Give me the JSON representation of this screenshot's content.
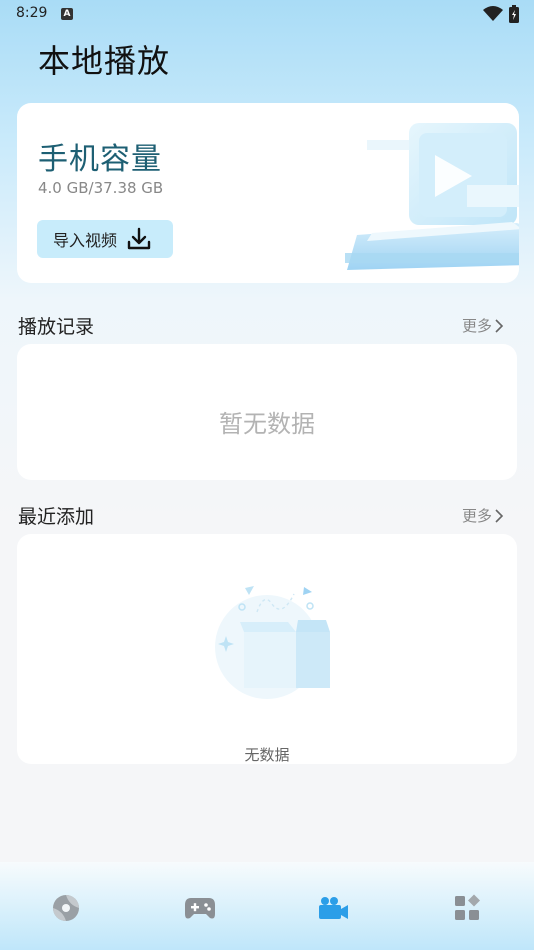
{
  "status_bar": {
    "time": "8:29",
    "notification_badge": "A"
  },
  "page": {
    "title": "本地播放"
  },
  "storage": {
    "title": "手机容量",
    "size": "4.0 GB/37.38 GB",
    "import_label": "导入视频",
    "import_icon": "download-icon"
  },
  "history": {
    "title": "播放记录",
    "more": "更多",
    "empty_text": "暂无数据"
  },
  "recent": {
    "title": "最近添加",
    "more": "更多",
    "empty_text": "无数据"
  },
  "bottom_nav": {
    "items": [
      {
        "name": "home-icon",
        "active": false
      },
      {
        "name": "gamepad-icon",
        "active": false
      },
      {
        "name": "video-camera-icon",
        "active": true
      },
      {
        "name": "apps-grid-icon",
        "active": false
      }
    ],
    "active_color": "#2b9ee8",
    "inactive_color": "#8a8f94"
  },
  "colors": {
    "accent": "#2b9ee8",
    "storage_title": "#1d5f73",
    "import_button_bg": "#c8ecfb"
  }
}
